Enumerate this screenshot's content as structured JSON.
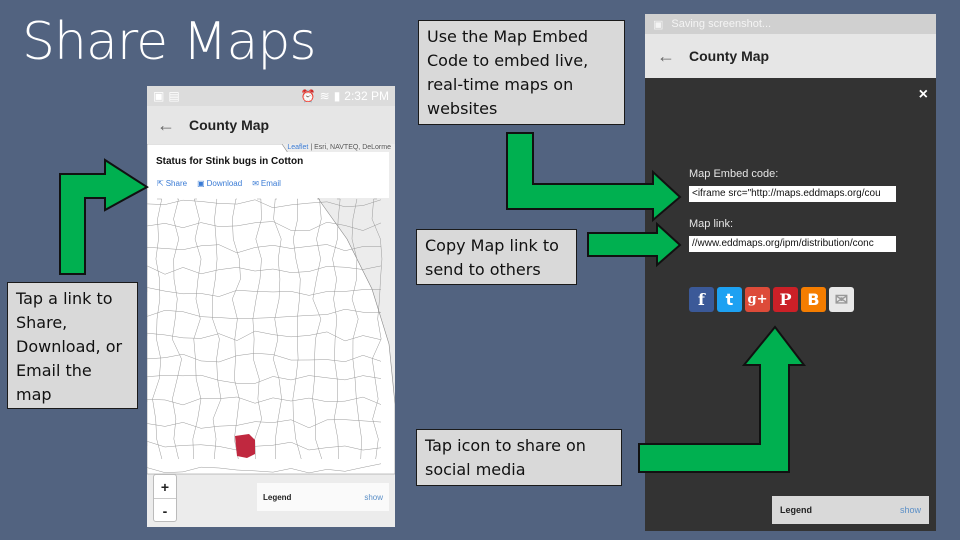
{
  "slide": {
    "title": "Share Maps"
  },
  "callouts": {
    "embed": "Use the Map Embed Code to embed live, real-time maps on websites",
    "tap_link": "Tap a link to Share, Download, or Email the map",
    "copy_link": "Copy Map link to send to others",
    "social": "Tap icon to share on social media"
  },
  "phone_left": {
    "status_time": "2:32 PM",
    "toolbar_title": "County Map",
    "attribution": {
      "leaflet": "Leaflet",
      "rest": " | Esri, NAVTEQ, DeLorme"
    },
    "status_card": {
      "title": "Status for Stink bugs in Cotton",
      "links": [
        {
          "icon": "share-icon",
          "label": "Share"
        },
        {
          "icon": "download-icon",
          "label": "Download"
        },
        {
          "icon": "email-icon",
          "label": "Email"
        }
      ]
    },
    "zoom_in": "+",
    "zoom_out": "-",
    "legend": {
      "label": "Legend",
      "toggle": "show"
    },
    "highlight_color": "#c0283f"
  },
  "phone_right": {
    "status_text": "Saving screenshot...",
    "toolbar_title": "County Map",
    "close": "×",
    "embed_label": "Map Embed code:",
    "embed_value": "<iframe src=\"http://maps.eddmaps.org/cou",
    "link_label": "Map link:",
    "link_value": "//www.eddmaps.org/ipm/distribution/conc",
    "social_icons": [
      {
        "name": "facebook",
        "glyph": "f",
        "color": "#3b5998"
      },
      {
        "name": "twitter",
        "glyph": "t",
        "color": "#1da1f2"
      },
      {
        "name": "google-plus",
        "glyph": "g+",
        "color": "#dd4b39"
      },
      {
        "name": "pinterest",
        "glyph": "P",
        "color": "#cb2027"
      },
      {
        "name": "blogger",
        "glyph": "B",
        "color": "#f57d00"
      },
      {
        "name": "email",
        "glyph": "✉",
        "color": "#e8e8e8"
      }
    ],
    "legend": {
      "label": "Legend",
      "toggle": "show"
    }
  },
  "colors": {
    "background": "#526380",
    "arrow": "#00b050"
  }
}
